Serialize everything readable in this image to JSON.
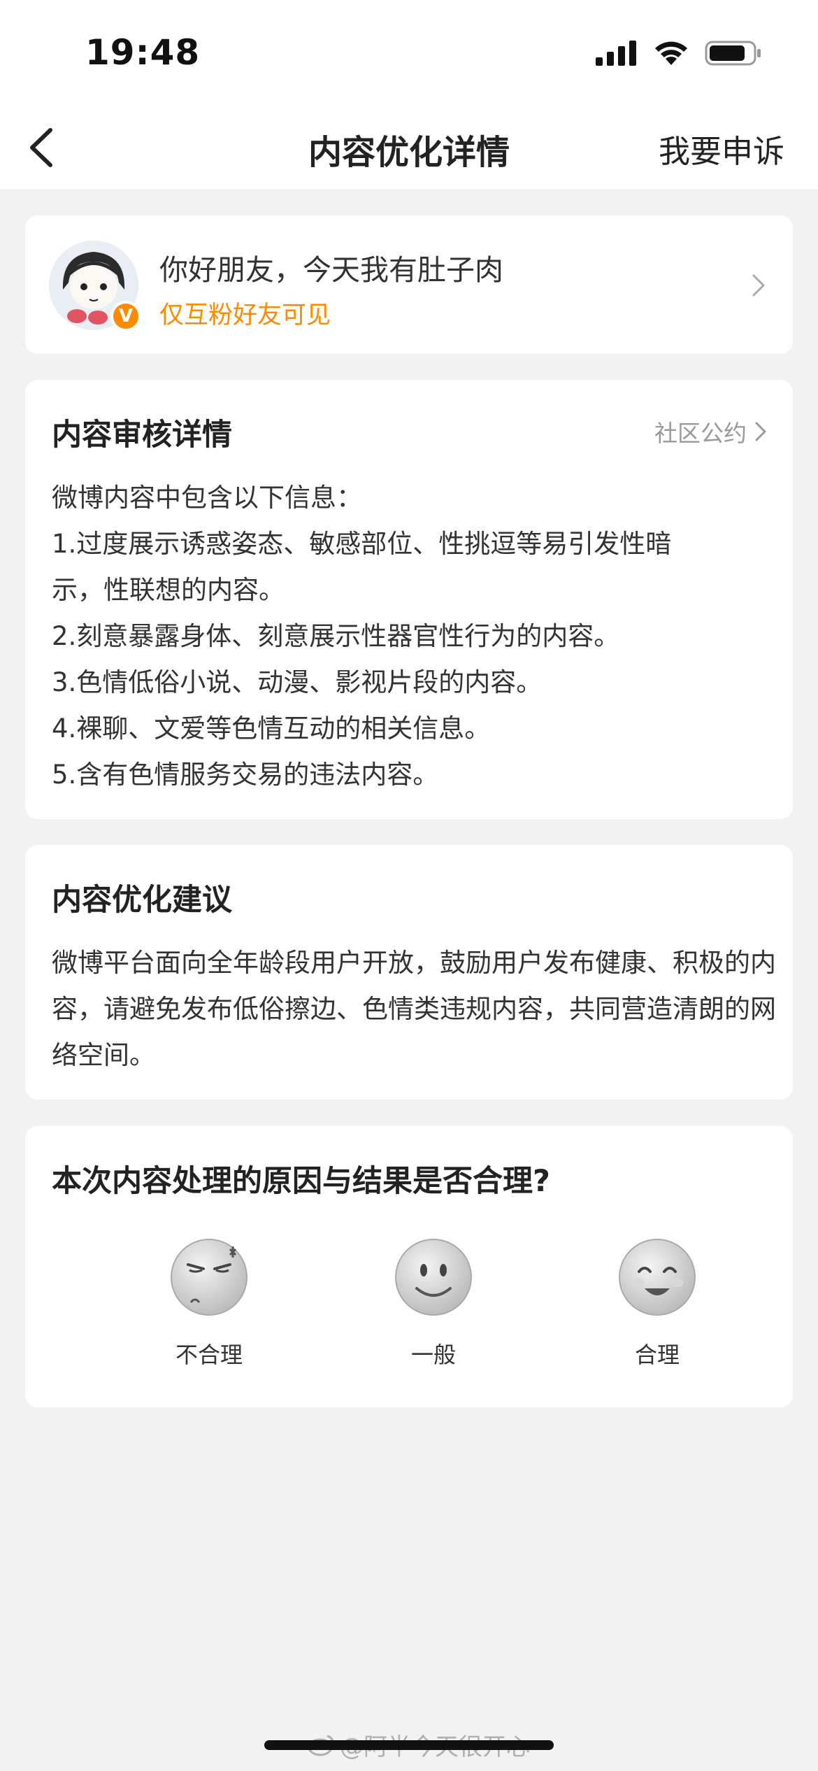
{
  "status_bar": {
    "time": "19:48"
  },
  "nav": {
    "title": "内容优化详情",
    "appeal_label": "我要申诉"
  },
  "post": {
    "text": "你好朋友，今天我有肚子肉",
    "visibility": "仅互粉好友可见",
    "verified_badge": "V"
  },
  "review": {
    "title": "内容审核详情",
    "guideline_link": "社区公约",
    "intro": "微博内容中包含以下信息：",
    "items": [
      "1.过度展示诱惑姿态、敏感部位、性挑逗等易引发性暗\n示，性联想的内容。",
      "2.刻意暴露身体、刻意展示性器官性行为的内容。",
      "3.色情低俗小说、动漫、影视片段的内容。",
      "4.裸聊、文爱等色情互动的相关信息。",
      "5.含有色情服务交易的违法内容。"
    ]
  },
  "suggestion": {
    "title": "内容优化建议",
    "body": "微博平台面向全年龄段用户开放，鼓励用户发布健康、积极的内容，请避免发布低俗擦边、色情类违规内容，共同营造清朗的网络空间。"
  },
  "feedback": {
    "question": "本次内容处理的原因与结果是否合理?",
    "options": [
      {
        "label": "不合理",
        "icon": "angry-face-icon"
      },
      {
        "label": "一般",
        "icon": "neutral-face-icon"
      },
      {
        "label": "合理",
        "icon": "happy-face-icon"
      }
    ]
  },
  "watermark": "@阿半今天很开心",
  "colors": {
    "accent": "#ff8a00",
    "background": "#f2f2f2",
    "card": "#ffffff"
  }
}
